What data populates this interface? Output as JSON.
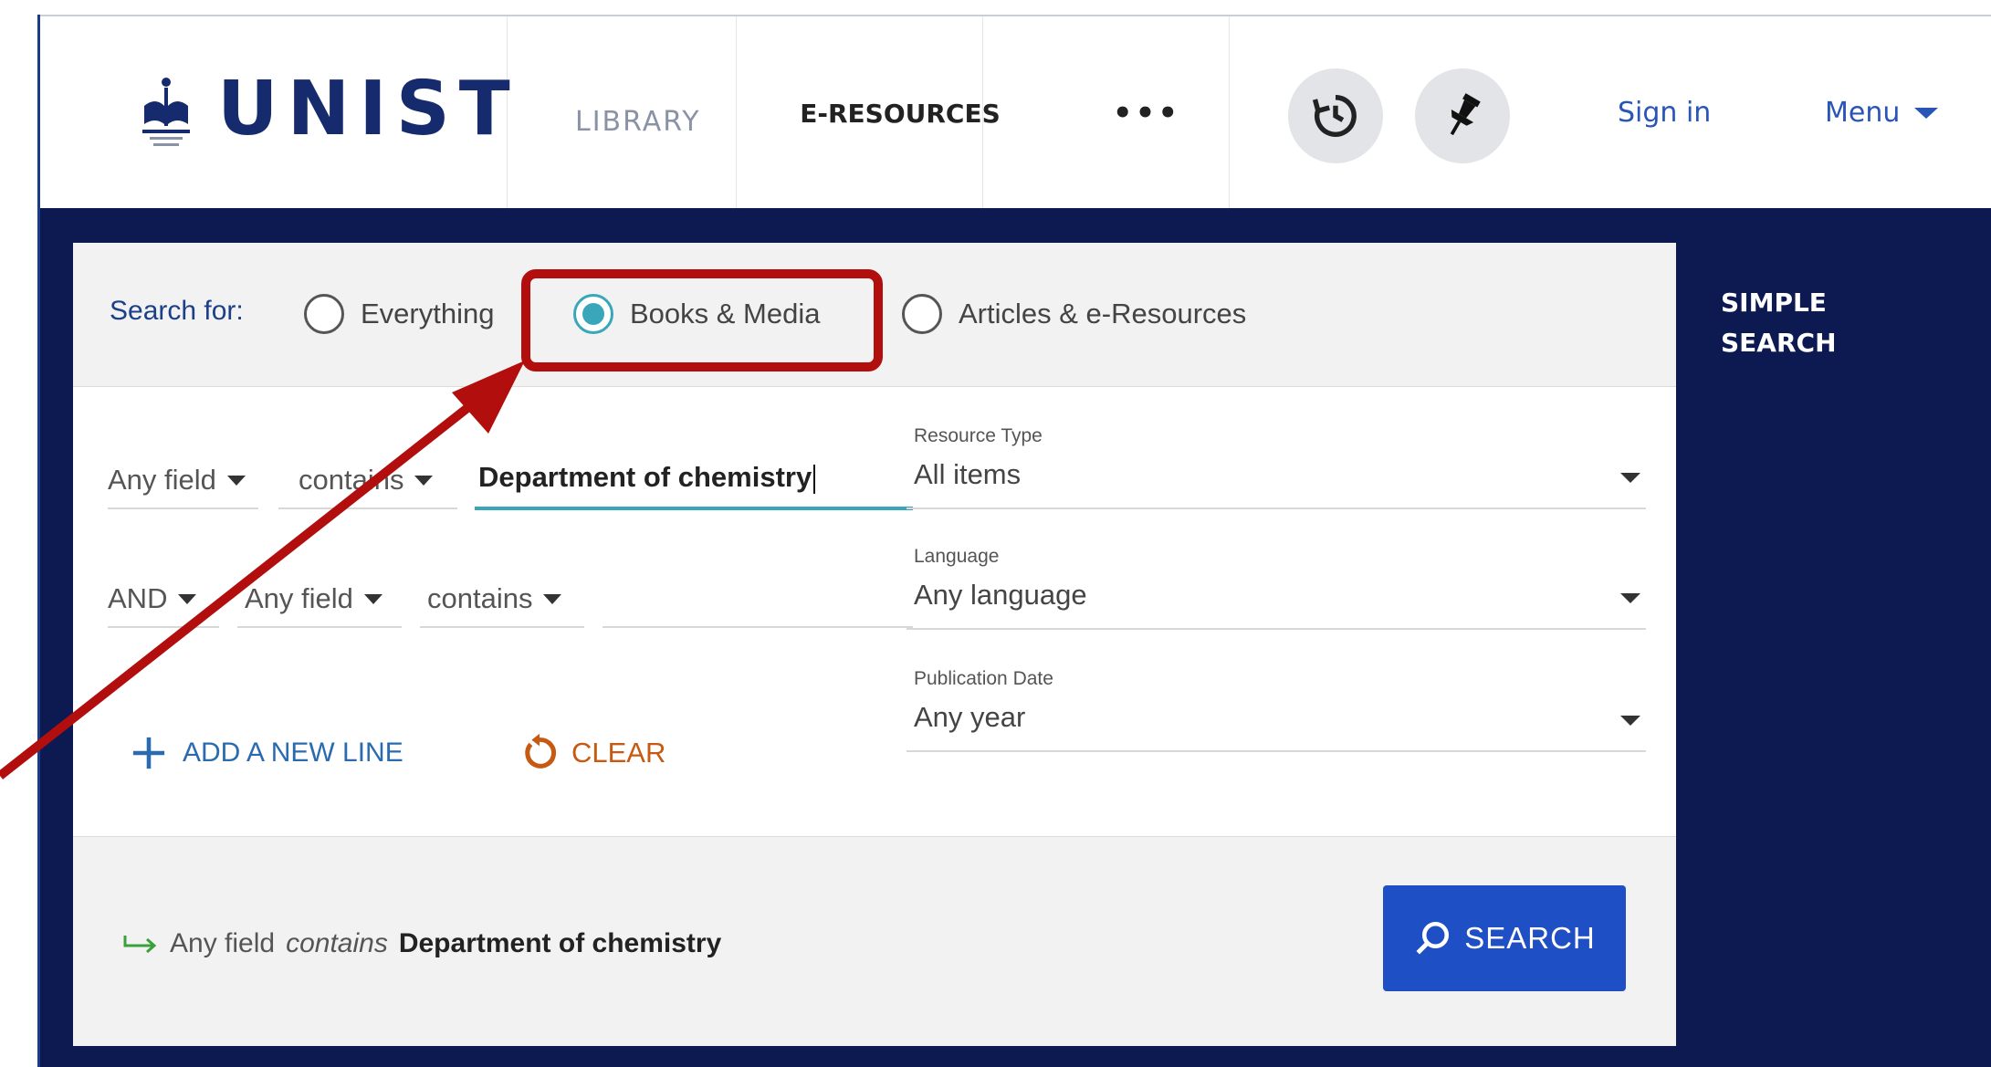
{
  "header": {
    "logo_text": "UNIST",
    "logo_sub": "LIBRARY",
    "nav_eresources": "E-RESOURCES",
    "nav_more": "•••",
    "history_icon": "history-icon",
    "pin_icon": "pin-icon",
    "signin_label": "Sign in",
    "menu_label": "Menu"
  },
  "search": {
    "search_for_label": "Search for:",
    "scopes": [
      {
        "label": "Everything",
        "selected": false
      },
      {
        "label": "Books & Media",
        "selected": true
      },
      {
        "label": "Articles & e-Resources",
        "selected": false
      }
    ],
    "row1": {
      "field": "Any field",
      "operator": "contains",
      "term": "Department of chemistry"
    },
    "row2": {
      "bool": "AND",
      "field": "Any field",
      "operator": "contains",
      "term": ""
    },
    "filters": [
      {
        "label": "Resource Type",
        "value": "All items"
      },
      {
        "label": "Language",
        "value": "Any language"
      },
      {
        "label": "Publication Date",
        "value": "Any year"
      }
    ],
    "add_line_label": "ADD A NEW LINE",
    "clear_label": "CLEAR",
    "summary": {
      "field": "Any field",
      "operator": "contains",
      "value": "Department of chemistry"
    },
    "search_button_label": "SEARCH",
    "simple_search_label": "SIMPLE SEARCH"
  },
  "colors": {
    "navy": "#0d1a52",
    "accent": "#3aa6b9",
    "search_button": "#1f4fc4",
    "annotation_red": "#b20e0e",
    "clear_orange": "#c65a12"
  }
}
